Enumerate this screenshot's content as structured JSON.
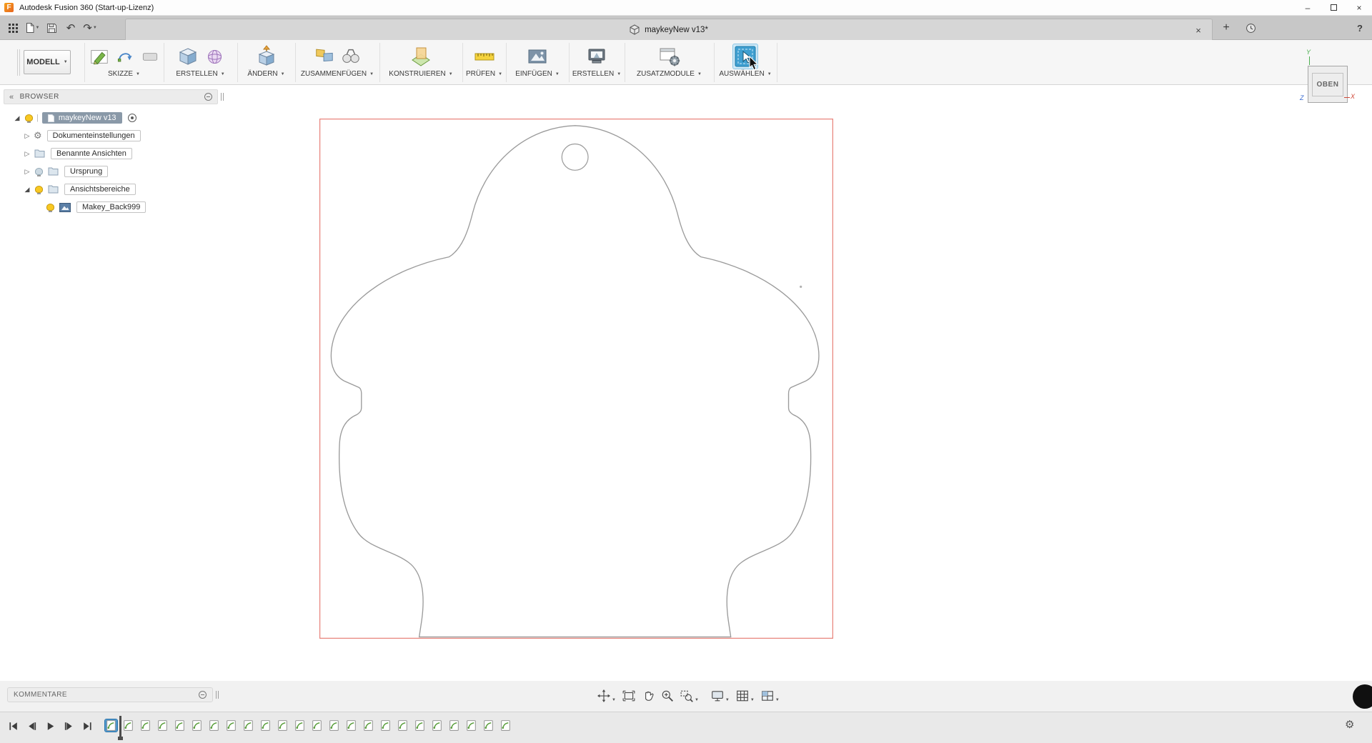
{
  "window": {
    "title": "Autodesk Fusion 360 (Start-up-Lizenz)"
  },
  "tabbar": {
    "document_tab": {
      "label": "maykeyNew v13*"
    }
  },
  "ribbon": {
    "workspace_label": "MODELL",
    "groups": [
      {
        "label": "SKIZZE"
      },
      {
        "label": "ERSTELLEN"
      },
      {
        "label": "ÄNDERN"
      },
      {
        "label": "ZUSAMMENFÜGEN"
      },
      {
        "label": "KONSTRUIEREN"
      },
      {
        "label": "PRÜFEN"
      },
      {
        "label": "EINFÜGEN"
      },
      {
        "label": "ERSTELLEN"
      },
      {
        "label": "ZUSATZMODULE"
      },
      {
        "label": "AUSWÄHLEN"
      }
    ]
  },
  "browser": {
    "header": "BROWSER",
    "root": {
      "label": "maykeyNew v13"
    },
    "items": [
      {
        "label": "Dokumenteinstellungen"
      },
      {
        "label": "Benannte Ansichten"
      },
      {
        "label": "Ursprung"
      },
      {
        "label": "Ansichtsbereiche"
      },
      {
        "label": "Makey_Back999"
      }
    ]
  },
  "viewcube": {
    "face": "OBEN",
    "axis_x": "X",
    "axis_y": "Y",
    "axis_z": "Z"
  },
  "comments": {
    "label": "KOMMENTARE"
  },
  "timeline": {
    "selected_index": 0,
    "features": [
      "sketch",
      "sketch",
      "sketch",
      "sketch",
      "sketch",
      "sketch",
      "sketch",
      "sketch",
      "sketch",
      "sketch",
      "sketch",
      "sketch",
      "sketch",
      "sketch",
      "sketch",
      "sketch",
      "sketch",
      "sketch",
      "sketch",
      "sketch",
      "sketch",
      "sketch",
      "sketch",
      "sketch"
    ]
  },
  "icons": {
    "caret": "▼",
    "collapse_left": "«",
    "undo": "↶",
    "redo": "↷",
    "close": "×",
    "plus": "+",
    "help": "?",
    "minimize": "–",
    "gear": "⚙",
    "expand_closed": "▷",
    "expand_open": "◢"
  },
  "colors": {
    "accent_blue": "#0696d7",
    "selection": "#8a99a8",
    "sketch_line": "#9b9b9b",
    "sketch_bounds": "#e8837b"
  }
}
